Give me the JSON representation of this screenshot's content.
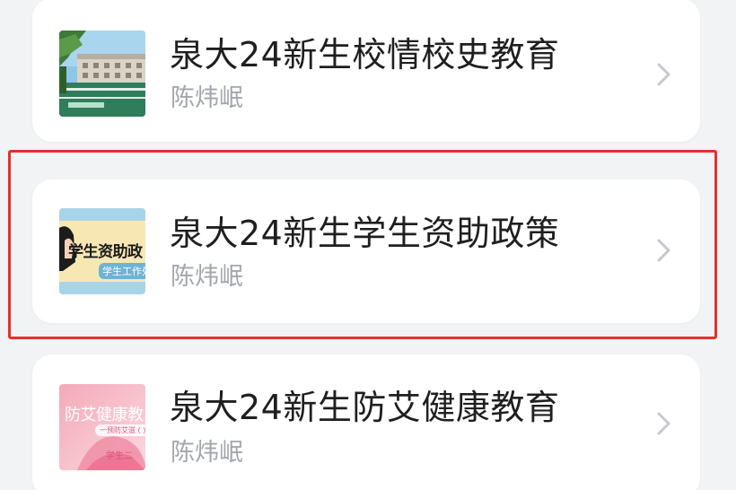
{
  "list": {
    "items": [
      {
        "title": "泉大24新生校情校史教育",
        "author": "陈炜岷",
        "thumbnail_icon": "campus-photo-thumbnail"
      },
      {
        "title": "泉大24新生学生资助政策",
        "author": "陈炜岷",
        "thumbnail_icon": "student-aid-thumbnail",
        "thumbnail_text": "学生资助政",
        "thumbnail_subtext": "学生工作处",
        "highlighted": true
      },
      {
        "title": "泉大24新生防艾健康教育",
        "author": "陈炜岷",
        "thumbnail_icon": "aids-prevention-thumbnail",
        "thumbnail_text": "防艾健康教",
        "thumbnail_band": "一预防艾滋 ( )",
        "thumbnail_subtext": "学生二"
      }
    ]
  },
  "colors": {
    "background": "#f2f3f5",
    "card": "#ffffff",
    "title": "#1f1f1f",
    "subtitle": "#a3a6ad",
    "chevron": "#c7c9ce",
    "highlight_border": "#e8302a"
  }
}
